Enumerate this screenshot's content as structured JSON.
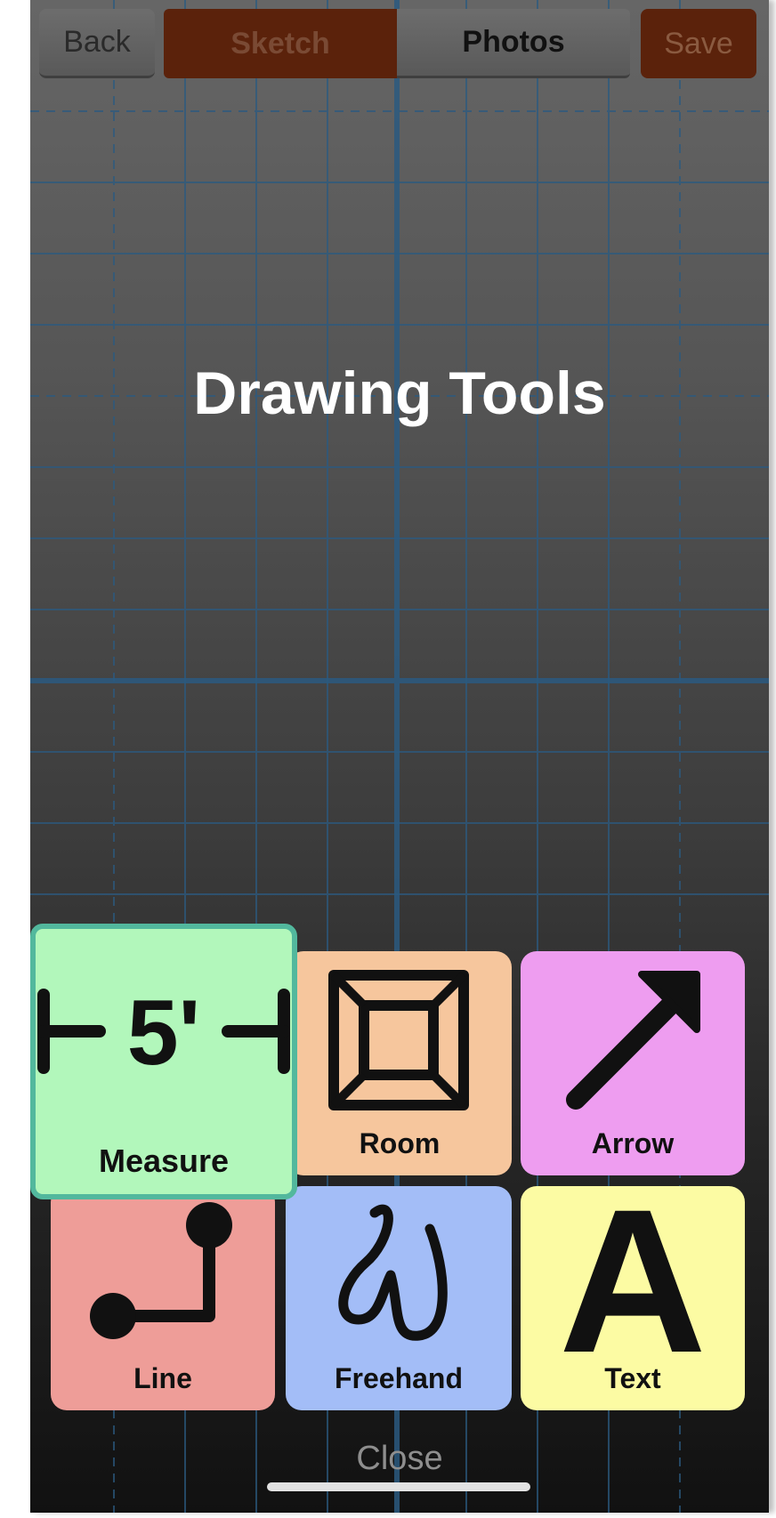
{
  "header": {
    "back_label": "Back",
    "sketch_label": "Sketch",
    "photos_label": "Photos",
    "save_label": "Save"
  },
  "title": "Drawing Tools",
  "tools": {
    "measure": {
      "label": "Measure",
      "glyph": "5'",
      "icon": "measure-icon",
      "color": "#b2f7bb",
      "selected": true
    },
    "room": {
      "label": "Room",
      "icon": "room-icon",
      "color": "#f6c69d"
    },
    "arrow": {
      "label": "Arrow",
      "icon": "arrow-icon",
      "color": "#ee9df0"
    },
    "line": {
      "label": "Line",
      "icon": "line-icon",
      "color": "#ee9d98"
    },
    "freehand": {
      "label": "Freehand",
      "icon": "freehand-icon",
      "color": "#a3bdf7"
    },
    "text": {
      "label": "Text",
      "glyph": "A",
      "icon": "text-icon",
      "color": "#fcfba3"
    }
  },
  "close_label": "Close",
  "colors": {
    "brand_brown": "#5b220b",
    "selection_border": "#52b89d",
    "grid_line": "#2b5a80"
  }
}
